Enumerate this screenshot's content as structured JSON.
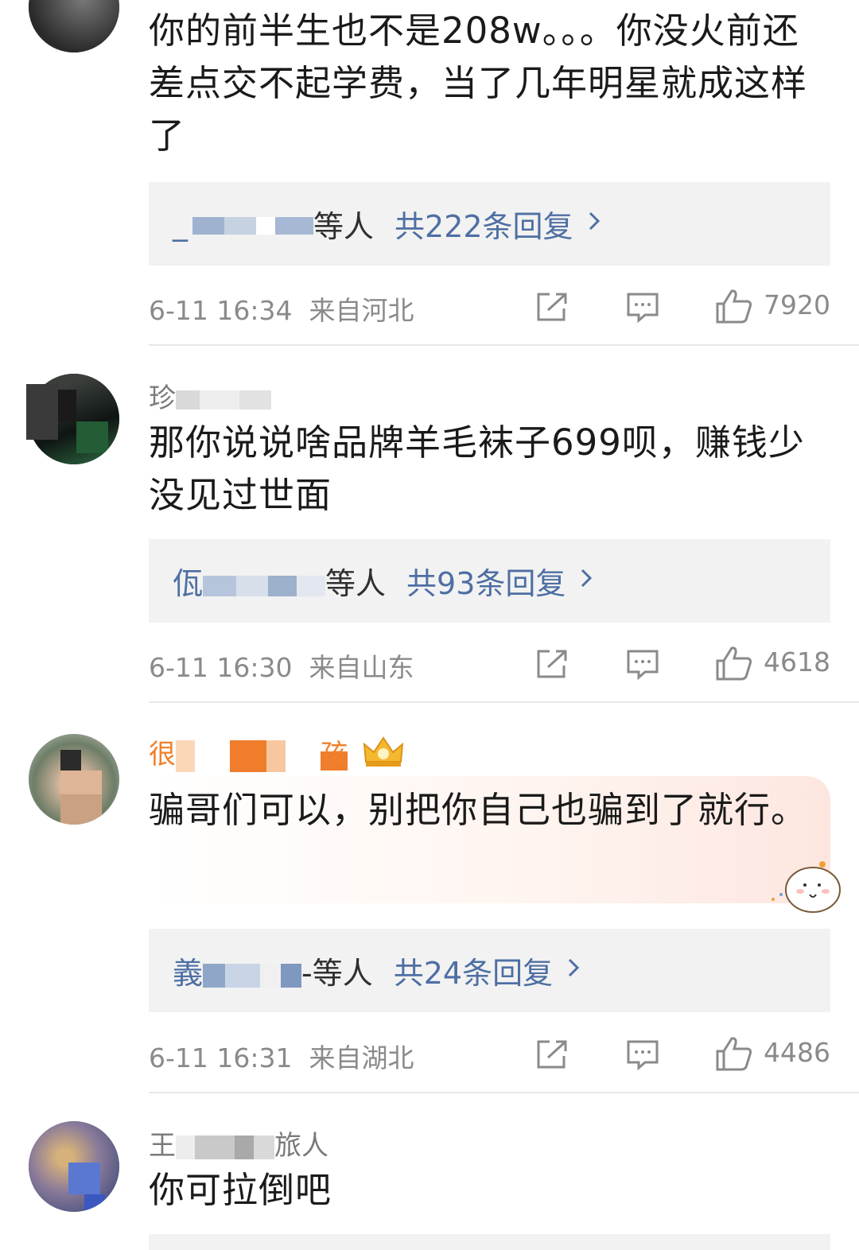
{
  "comments": [
    {
      "username": "",
      "text": "你的前半生也不是208w。。。你没火前还差点交不起学费，当了几年明星就成这样了",
      "reply_names_tail": "等人",
      "reply_count": "共222条回复",
      "time": "6-11 16:34",
      "location": "来自河北",
      "likes": "7920"
    },
    {
      "username": "珍",
      "text": "那你说说啥品牌羊毛袜子699呗，赚钱少没见过世面",
      "reply_names_head": "佤",
      "reply_names_tail": "等人",
      "reply_count": "共93条回复",
      "time": "6-11 16:30",
      "location": "来自山东",
      "likes": "4618"
    },
    {
      "username": "很",
      "username_tail": "孩",
      "text": "骗哥们可以，别把你自己也骗到了就行。",
      "reply_names_head": "義",
      "reply_names_tail": "-等人",
      "reply_count": "共24条回复",
      "time": "6-11 16:31",
      "location": "来自湖北",
      "likes": "4486"
    },
    {
      "username": "王",
      "username_tail": "旅人",
      "text": "你可拉倒吧"
    }
  ],
  "icons": {
    "repost": "share-icon",
    "comment": "comment-icon",
    "like": "thumbs-up-icon",
    "chevron": "chevron-right-icon",
    "badge": "crown-badge-icon"
  },
  "colors": {
    "link": "#4e6fa3",
    "vip_name": "#f0802b",
    "meta": "#8a8a8a"
  }
}
